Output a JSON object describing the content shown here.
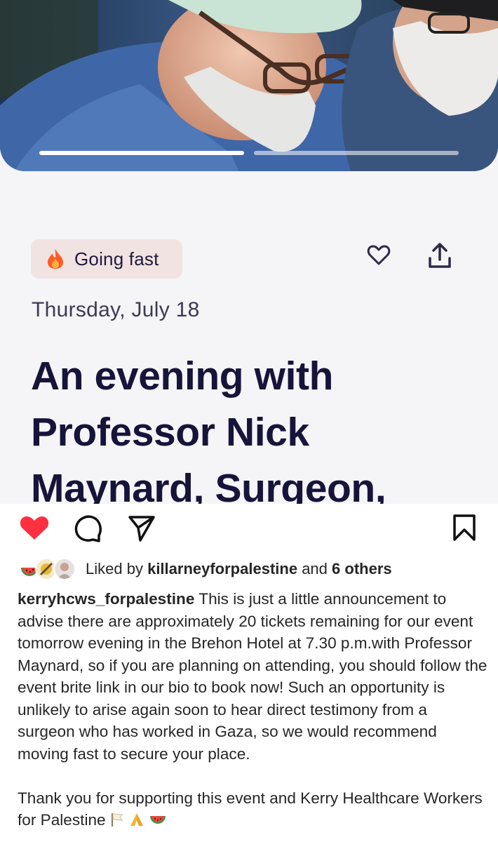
{
  "event": {
    "badge_label": "Going fast",
    "badge_icon": "fire-icon",
    "date": "Thursday, July 18",
    "title": "An evening with Professor Nick Maynard, Surgeon,",
    "actions": {
      "save_icon": "heart-outline-icon",
      "share_icon": "share-up-icon"
    },
    "carousel": {
      "slides": 2,
      "active_index": 0
    }
  },
  "post": {
    "actions": [
      "heart-filled-icon",
      "comment-icon",
      "send-icon",
      "bookmark-icon"
    ],
    "likes": {
      "prefix": "Liked by",
      "user": "killarneyforpalestine",
      "joiner": "and",
      "others": "6 others"
    },
    "caption": {
      "username": "kerryhcws_forpalestine",
      "text": "This is just a little announcement to advise there are  approximately 20 tickets remaining for our event tomorrow evening in the Brehon Hotel at 7.30 p.m.with Professor Maynard, so if you are planning on attending, you should follow the event brite link in our bio to book now! Such an opportunity is unlikely to arise again soon  to hear direct testimony from a surgeon who has worked in Gaza, so we would recommend moving fast to secure your place.",
      "text2": "Thank you for supporting this event and Kerry Healthcare Workers for Palestine"
    }
  },
  "colors": {
    "title": "#16143a",
    "badge_bg": "#f2e3e3",
    "card_bg": "#f5f4f6",
    "like_red": "#ff3040"
  }
}
